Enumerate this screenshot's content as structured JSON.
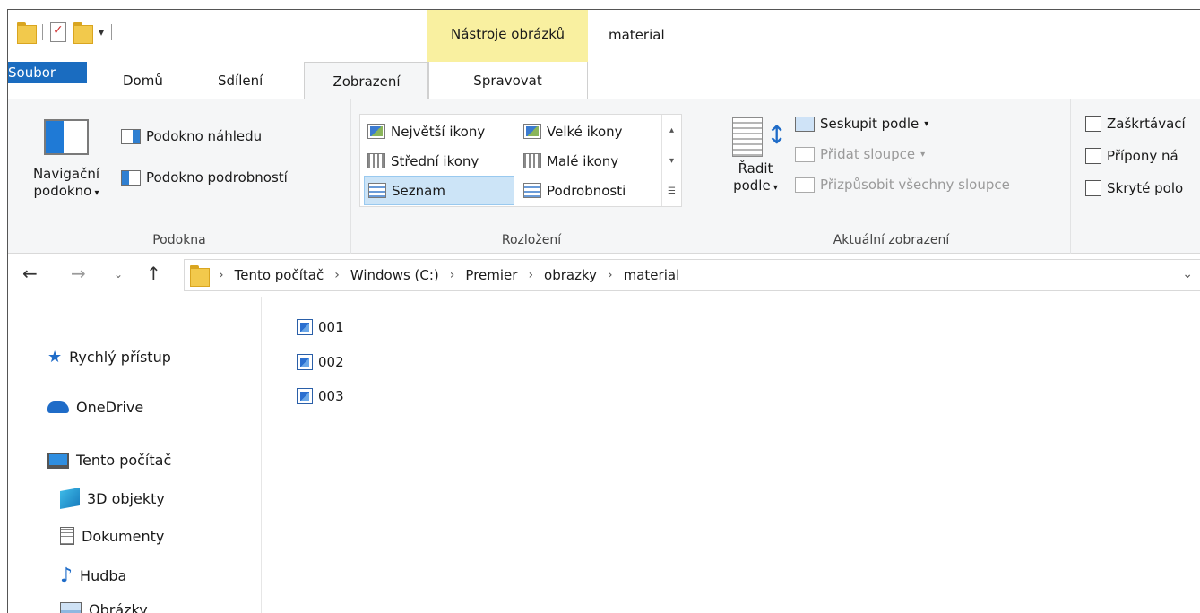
{
  "window": {
    "title": "material",
    "context_tab_group": "Nástroje obrázků"
  },
  "tabs": [
    {
      "label": "Soubor"
    },
    {
      "label": "Domů"
    },
    {
      "label": "Sdílení"
    },
    {
      "label": "Zobrazení"
    },
    {
      "label": "Spravovat"
    }
  ],
  "active_tab": "Zobrazení",
  "ribbon": {
    "panes": {
      "nav_pane_line1": "Navigační",
      "nav_pane_line2": "podokno",
      "preview_pane": "Podokno náhledu",
      "details_pane": "Podokno podrobností",
      "label": "Podokna"
    },
    "layout": {
      "items": [
        "Největší ikony",
        "Velké ikony",
        "Střední ikony",
        "Malé ikony",
        "Seznam",
        "Podrobnosti"
      ],
      "selected": "Seznam",
      "label": "Rozložení"
    },
    "current_view": {
      "sort_line1": "Řadit",
      "sort_line2": "podle",
      "group_by": "Seskupit podle",
      "add_columns": "Přidat sloupce",
      "fit_columns": "Přizpůsobit všechny sloupce",
      "label": "Aktuální zobrazení"
    },
    "show_hide": {
      "item_checkboxes": "Zaškrtávací",
      "extensions": "Přípony ná",
      "hidden_items": "Skryté polo"
    }
  },
  "address": {
    "crumbs": [
      "Tento počítač",
      "Windows (C:)",
      "Premier",
      "obrazky",
      "material"
    ]
  },
  "nav": {
    "quick_access": "Rychlý přístup",
    "onedrive": "OneDrive",
    "this_pc": "Tento počítač",
    "children": [
      "3D objekty",
      "Dokumenty",
      "Hudba",
      "Obrázky"
    ]
  },
  "files": [
    "001",
    "002",
    "003"
  ],
  "colors": {
    "file_tab": "#1a6cc0",
    "context_tab": "#f9f0a0",
    "selection": "#cce4f7"
  }
}
